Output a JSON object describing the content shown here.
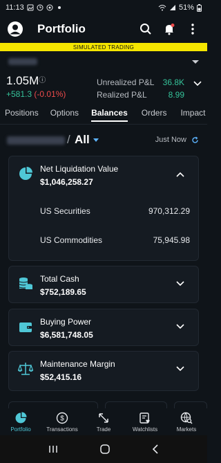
{
  "status_bar": {
    "time": "11:13",
    "battery": "51%"
  },
  "app_bar": {
    "title": "Portfolio"
  },
  "banner": {
    "text": "SIMULATED TRADING"
  },
  "summary": {
    "net_value": "1.05M",
    "info_glyph": "ⓘ",
    "change": "+581.3",
    "change_pct": "(-0.01%)",
    "unrealized_label": "Unrealized P&L",
    "unrealized_value": "36.8K",
    "realized_label": "Realized P&L",
    "realized_value": "8.99"
  },
  "tabs": [
    "Positions",
    "Options",
    "Balances",
    "Orders",
    "Impact Len"
  ],
  "active_tab": "Balances",
  "account_filter": {
    "separator": "/",
    "label": "All",
    "updated": "Just Now"
  },
  "cards": {
    "nlv": {
      "title": "Net Liquidation Value",
      "value": "$1,046,258.27",
      "expanded": true,
      "rows": [
        {
          "label": "US Securities",
          "value": "970,312.29"
        },
        {
          "label": "US Commodities",
          "value": "75,945.98"
        }
      ]
    },
    "cash": {
      "title": "Total Cash",
      "value": "$752,189.65"
    },
    "buying_power": {
      "title": "Buying Power",
      "value": "$6,581,748.05"
    },
    "maintenance": {
      "title": "Maintenance Margin",
      "value": "$52,415.16"
    }
  },
  "bottom_nav": {
    "portfolio": "Portfolio",
    "transactions": "Transactions",
    "trade": "Trade",
    "watchlists": "Watchlists",
    "markets": "Markets"
  },
  "colors": {
    "background": "#0f1419",
    "card": "#151b22",
    "accent_teal": "#4fc7d6",
    "positive": "#35c39a",
    "negative": "#ee4b4b",
    "banner": "#f5e600",
    "link_blue": "#5db4ff"
  },
  "icons": {
    "status_left": [
      "image-icon",
      "clock-icon",
      "circle-icon",
      "dot-icon"
    ],
    "status_right": [
      "wifi-icon",
      "signal-icon",
      "battery-icon"
    ],
    "app_bar": [
      "avatar-icon",
      "search-icon",
      "bell-icon",
      "more-vertical-icon"
    ],
    "cards": [
      "pie-chart-icon",
      "coins-icon",
      "wallet-icon",
      "scale-icon"
    ],
    "nav": [
      "portfolio-icon",
      "transactions-icon",
      "trade-icon",
      "watchlists-icon",
      "markets-icon"
    ]
  }
}
